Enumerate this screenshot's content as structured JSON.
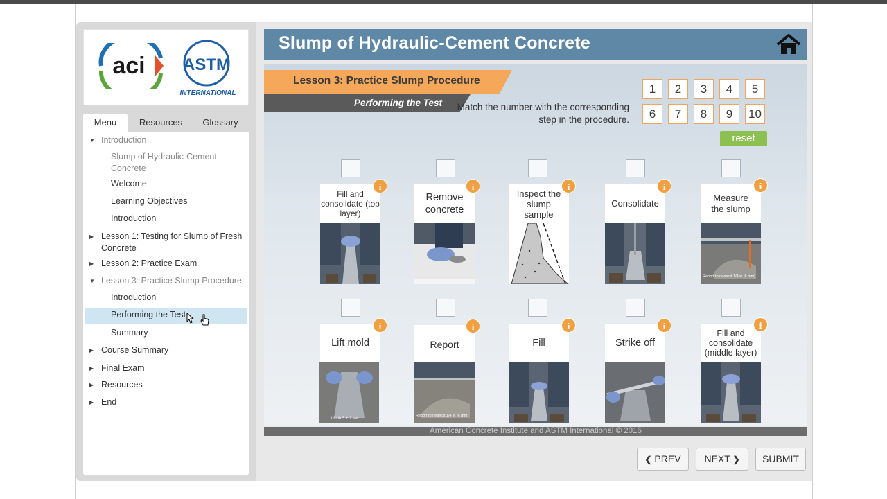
{
  "course": {
    "title": "Slump of Hydraulic-Cement Concrete"
  },
  "logos": {
    "aci": "aci",
    "astm_top": "ASTM",
    "astm_bottom": "INTERNATIONAL"
  },
  "sidebar": {
    "tabs": [
      "Menu",
      "Resources",
      "Glossary"
    ],
    "items": [
      {
        "label": "Introduction",
        "level": 0,
        "expanded": true,
        "dim": true
      },
      {
        "label": "Slump of Hydraulic-Cement Concrete",
        "level": 1,
        "dim": true
      },
      {
        "label": "Welcome",
        "level": 1
      },
      {
        "label": "Learning Objectives",
        "level": 1
      },
      {
        "label": "Introduction",
        "level": 1
      },
      {
        "label": "Lesson 1: Testing for Slump of Fresh Concrete",
        "level": 0
      },
      {
        "label": "Lesson 2: Practice Exam",
        "level": 0
      },
      {
        "label": "Lesson 3: Practice Slump Procedure",
        "level": 0,
        "expanded": true,
        "dim": true
      },
      {
        "label": "Introduction",
        "level": 1
      },
      {
        "label": "Performing the Test",
        "level": 1,
        "selected": true
      },
      {
        "label": "Summary",
        "level": 1
      },
      {
        "label": "Course Summary",
        "level": 0
      },
      {
        "label": "Final Exam",
        "level": 0
      },
      {
        "label": "Resources",
        "level": 0
      },
      {
        "label": "End",
        "level": 0
      }
    ]
  },
  "lesson": {
    "title": "Lesson 3: Practice Slump Procedure",
    "subtitle": "Performing the Test",
    "instructions": "Match the number with the corresponding step in the procedure.",
    "numbers": [
      "1",
      "2",
      "3",
      "4",
      "5",
      "6",
      "7",
      "8",
      "9",
      "10"
    ],
    "reset_label": "reset",
    "cards": [
      {
        "label": "Fill and consolidate (top layer)",
        "photo": "hands-on-cone"
      },
      {
        "label": "Remove concrete",
        "photo": "hand-wiping-base"
      },
      {
        "label": "Inspect the slump sample",
        "photo": "slump-diagram"
      },
      {
        "label": "Consolidate",
        "photo": "rodding-cone"
      },
      {
        "label": "Measure the slump",
        "photo": "rod-over-cone"
      },
      {
        "label": "Lift mold",
        "photo": "lifting-cone"
      },
      {
        "label": "Report",
        "photo": "slumped-concrete"
      },
      {
        "label": "Fill",
        "photo": "standing-on-cone"
      },
      {
        "label": "Strike off",
        "photo": "rod-strike-off"
      },
      {
        "label": "Fill and consolidate (middle layer)",
        "photo": "hands-on-cone-2"
      }
    ],
    "photo_captions": {
      "measure": "Report to nearest 1/4 in [6 mm]",
      "lift": "Lift in 5 ± 2 sec",
      "report": "Report to nearest 1/4 in [6 mm]"
    }
  },
  "footer": {
    "copyright": "American Concrete Institute and ASTM International © 2016"
  },
  "nav": {
    "prev": "PREV",
    "next": "NEXT",
    "submit": "SUBMIT"
  },
  "colors": {
    "header": "#5f88a7",
    "lesson_banner": "#f5a75a",
    "sub_banner": "#5a5a5a",
    "reset": "#8cc152",
    "info": "#f0a040"
  }
}
